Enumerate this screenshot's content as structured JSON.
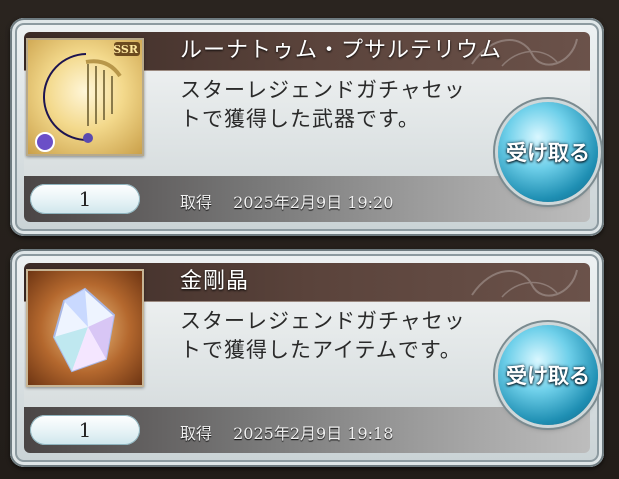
{
  "items": [
    {
      "title": "ルーナトゥム・プサルテリウム",
      "description": "スターレジェンドガチャセットで獲得した武器です。",
      "quantity": "1",
      "acquired_label": "取得",
      "acquired_time": "2025年2月9日 19:20",
      "receive_label": "受け取る",
      "rarity_badge": "SSR",
      "thumbnail": "weapon-harp-icon"
    },
    {
      "title": "金剛晶",
      "description": "スターレジェンドガチャセットで獲得したアイテムです。",
      "quantity": "1",
      "acquired_label": "取得",
      "acquired_time": "2025年2月9日 19:18",
      "receive_label": "受け取る",
      "thumbnail": "crystal-gem-icon"
    }
  ],
  "colors": {
    "accent_button": "#1f8fb3",
    "title_bar": "#4a3530"
  }
}
